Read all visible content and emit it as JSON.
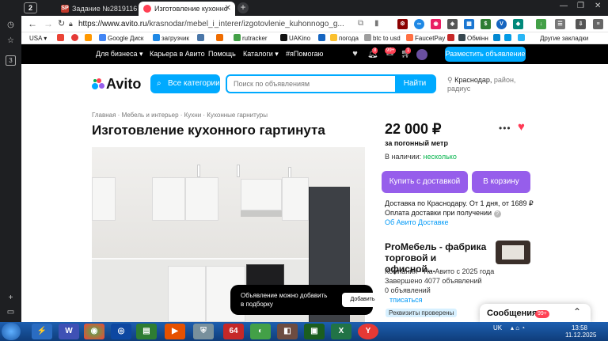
{
  "browser": {
    "tab_count": "2",
    "tabs": [
      {
        "label": "Задание №2819116 - про",
        "favicon": "SP",
        "active": false
      },
      {
        "label": "Изготовление кухонно",
        "favicon": "",
        "active": true
      }
    ],
    "url_host": "https://www.avito.ru",
    "url_path": "/krasnodar/mebel_i_interer/izgotovlenie_kuhonnogo_g...",
    "bookmarks": [
      "USA",
      "G",
      "Google Диск",
      "загрузчик",
      "rutracker",
      "UAKino",
      "погода",
      "btc to usd",
      "FaucetPay",
      "Обмінн",
      "Другие закладки"
    ],
    "icons": {
      "back": "arrow-left-icon",
      "forward": "arrow-right-icon",
      "reload": "reload-icon",
      "lock": "lock-icon"
    }
  },
  "avito_nav": {
    "links": [
      "Для бизнеса",
      "Карьера в Авито",
      "Помощь",
      "Каталоги",
      "#яПомогаю"
    ],
    "badges": {
      "notifications": "8",
      "messages": "99+",
      "cart": "1"
    },
    "post_button": "Разместить объявление"
  },
  "header": {
    "logo": "Avito",
    "categories_button": "Все категории",
    "search_placeholder": "Поиск по объявлениям",
    "search_button": "Найти",
    "location_city": "Краснодар,",
    "location_rest": " район, радиус"
  },
  "breadcrumbs": [
    "Главная",
    "Мебель и интерьер",
    "Кухни",
    "Кухонные гарнитуры"
  ],
  "listing": {
    "title": "Изготовление кухонного гартинута",
    "price": "22 000 ₽",
    "unit": "за погонный метр",
    "stock_label": "В наличии:",
    "stock_value": "несколько",
    "btn_delivery": "Купить с доставкой",
    "btn_cart": "В корзину",
    "delivery_line1": "Доставка по Краснодару. От 1 дня, от 1689 ₽",
    "delivery_line2": "Оплата доставки при получении",
    "delivery_link": "Об Авито Доставке"
  },
  "seller": {
    "name": "ProМебель - фабрика торговой и офисной...",
    "info1": "Компания · На Авито с 2025 года",
    "info2": "Завершено 4077 объявлений",
    "info3": "0 объявлений",
    "subscribe": "тписаться",
    "verified": "Реквизиты проверены"
  },
  "toast": {
    "text_line1": "Объявление можно добавить",
    "text_line2": "в подборку",
    "button": "Добавить"
  },
  "messages": {
    "title": "Сообщения",
    "badge": "99+"
  },
  "taskbar": {
    "lang": "UK",
    "time": "13:58",
    "date": "11.12.2025",
    "app_label_64": "64"
  },
  "colors": {
    "avito_blue": "#00aaff",
    "avito_purple": "#965eeb",
    "avito_green": "#02b34a",
    "heart": "#ff3a55"
  }
}
